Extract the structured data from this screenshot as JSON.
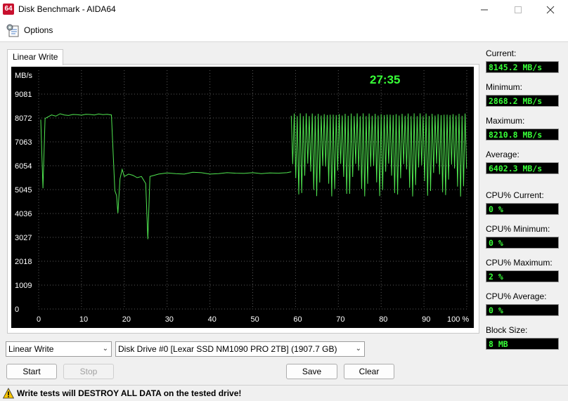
{
  "window": {
    "app_badge": "64",
    "title": "Disk Benchmark - AIDA64",
    "minimize_icon": "minimize-icon",
    "maximize_icon": "maximize-icon",
    "close_icon": "close-icon"
  },
  "menu": {
    "options_label": "Options",
    "options_icon": "options-icon"
  },
  "tab": {
    "label": "Linear Write"
  },
  "chart_data": {
    "type": "line",
    "ylabel": "MB/s",
    "yticks": [
      0,
      1009,
      2018,
      3027,
      4036,
      5045,
      6054,
      7063,
      8072,
      9081
    ],
    "xticks": [
      "0",
      "10",
      "20",
      "30",
      "40",
      "50",
      "60",
      "70",
      "80",
      "90",
      "100 %"
    ],
    "ylim": [
      0,
      10090
    ],
    "xlim": [
      0,
      100
    ],
    "timer": "27:35",
    "grid": true,
    "line_color": "#50e650",
    "series": [
      {
        "x": [
          0.5,
          1,
          1.5,
          2,
          3,
          4,
          5,
          6,
          7,
          8,
          9,
          10,
          11,
          12,
          13,
          14,
          15,
          16,
          17,
          17.8,
          18.2,
          18.5,
          19,
          19.5,
          20,
          21,
          22,
          23,
          24,
          25,
          25.5,
          26,
          27,
          28,
          30,
          32,
          34,
          36,
          38,
          40,
          42,
          44,
          46,
          48,
          50,
          52,
          54,
          56,
          58,
          59
        ],
        "y": [
          8000,
          5100,
          8050,
          8100,
          8200,
          8150,
          8250,
          8200,
          8180,
          8220,
          8210,
          8190,
          8230,
          8220,
          8200,
          8240,
          8210,
          8230,
          8200,
          5000,
          4800,
          4050,
          5500,
          5900,
          5600,
          5700,
          5650,
          5550,
          5600,
          5300,
          2950,
          5600,
          5650,
          5700,
          5750,
          5720,
          5700,
          5780,
          5760,
          5700,
          5720,
          5760,
          5740,
          5730,
          5760,
          5720,
          5750,
          5740,
          5760,
          5800
        ]
      }
    ]
  },
  "stats": [
    {
      "label": "Current:",
      "value": "8145.2 MB/s"
    },
    {
      "label": "Minimum:",
      "value": "2868.2 MB/s"
    },
    {
      "label": "Maximum:",
      "value": "8210.8 MB/s"
    },
    {
      "label": "Average:",
      "value": "6402.3 MB/s"
    },
    {
      "label": "CPU% Current:",
      "value": "0 %"
    },
    {
      "label": "CPU% Minimum:",
      "value": "0 %"
    },
    {
      "label": "CPU% Maximum:",
      "value": "2 %"
    },
    {
      "label": "CPU% Average:",
      "value": "0 %"
    },
    {
      "label": "Block Size:",
      "value": "8 MB"
    }
  ],
  "controls": {
    "test_select": "Linear Write",
    "drive_select": "Disk Drive #0  [Lexar SSD NM1090 PRO 2TB]  (1907.7 GB)",
    "start": "Start",
    "stop": "Stop",
    "save": "Save",
    "clear": "Clear"
  },
  "status": {
    "warning": "Write tests will DESTROY ALL DATA on the tested drive!"
  }
}
